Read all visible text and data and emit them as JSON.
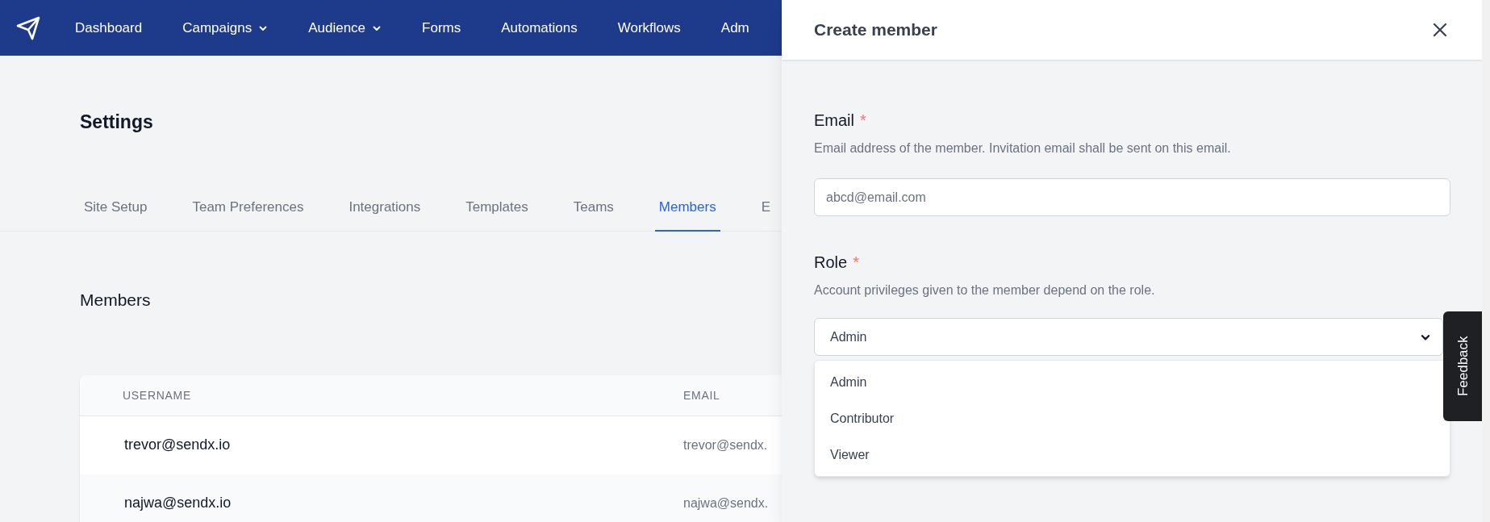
{
  "nav": {
    "items": [
      {
        "label": "Dashboard",
        "dropdown": false
      },
      {
        "label": "Campaigns",
        "dropdown": true
      },
      {
        "label": "Audience",
        "dropdown": true
      },
      {
        "label": "Forms",
        "dropdown": false
      },
      {
        "label": "Automations",
        "dropdown": false
      },
      {
        "label": "Workflows",
        "dropdown": false
      },
      {
        "label": "Adm",
        "dropdown": false
      }
    ]
  },
  "page": {
    "title": "Settings",
    "tabs": [
      {
        "label": "Site Setup",
        "selected": false
      },
      {
        "label": "Team Preferences",
        "selected": false
      },
      {
        "label": "Integrations",
        "selected": false
      },
      {
        "label": "Templates",
        "selected": false
      },
      {
        "label": "Teams",
        "selected": false
      },
      {
        "label": "Members",
        "selected": true
      },
      {
        "label": "E",
        "selected": false
      }
    ],
    "section_title": "Members",
    "table": {
      "columns": [
        "USERNAME",
        "EMAIL"
      ],
      "rows": [
        [
          "trevor@sendx.io",
          "trevor@sendx."
        ],
        [
          "najwa@sendx.io",
          "najwa@sendx."
        ]
      ]
    }
  },
  "drawer": {
    "title": "Create member",
    "fields": [
      {
        "kind": "text",
        "label": "Email",
        "required_mark": "*",
        "description": "Email address of the member. Invitation email shall be sent on this email.",
        "placeholder": "abcd@email.com"
      },
      {
        "kind": "select",
        "label": "Role",
        "required_mark": "*",
        "description": "Account privileges given to the member depend on the role.",
        "value": "Admin",
        "options": [
          "Admin",
          "Contributor",
          "Viewer"
        ]
      }
    ]
  },
  "feedback": {
    "label": "Feedback"
  }
}
